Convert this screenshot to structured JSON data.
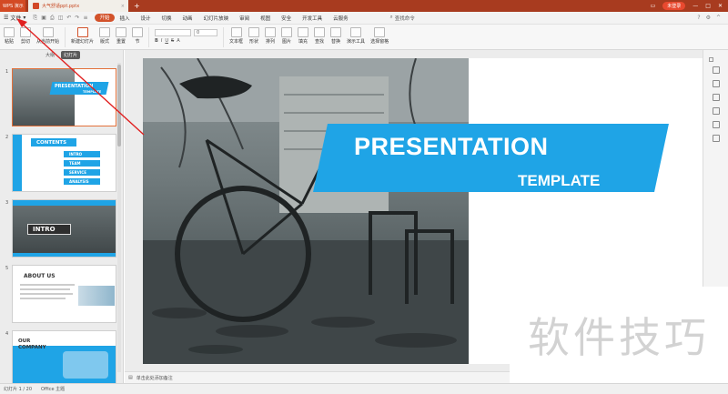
{
  "titlebar": {
    "app_tab": "WPS 演示",
    "doc_tab": "大气舒适ppt.pptx",
    "login_label": "未登录"
  },
  "menubar": {
    "file_label": "文件",
    "tabs": [
      "开始",
      "插入",
      "设计",
      "切换",
      "动画",
      "幻灯片放映",
      "审阅",
      "视图",
      "安全",
      "开发工具",
      "云服务"
    ],
    "search_label": "查找命令"
  },
  "toolbar": {
    "paste": "粘贴",
    "cut": "剪切",
    "from_start": "从当前开始",
    "new_slide": "新建幻灯片",
    "layout": "版式",
    "reset": "重置",
    "section": "节",
    "font_size": "0",
    "textbox": "文本框",
    "shape": "形状",
    "arrange": "排列",
    "picture": "图片",
    "fill": "填充",
    "find": "查找",
    "replace": "替换",
    "tools": "演示工具",
    "select_pane": "选择窗格"
  },
  "left_panel": {
    "tabs": [
      "大纲",
      "幻灯片"
    ],
    "slides": [
      {
        "num": "1",
        "title": "PRESENTATION",
        "sub": "TEMPLATE"
      },
      {
        "num": "2",
        "title": "CONTENTS",
        "items": [
          "INTRO",
          "TEAM",
          "SERVICE",
          "ANALYSIS"
        ]
      },
      {
        "num": "3",
        "title": "INTRO"
      },
      {
        "num": "5",
        "title": "ABOUT US"
      },
      {
        "num": "4",
        "title": "OUR COMPANY"
      }
    ]
  },
  "slide": {
    "title": "PRESENTATION",
    "subtitle": "TEMPLATE"
  },
  "notes": "单击此处添加备注",
  "status": {
    "slide_info": "幻灯片 1 / 20",
    "theme": "Office 主题"
  },
  "watermark": "软件技巧",
  "colors": {
    "accent_blue": "#1fa4e6",
    "titlebar": "#a83b1f",
    "active_tab": "#d2522b"
  }
}
